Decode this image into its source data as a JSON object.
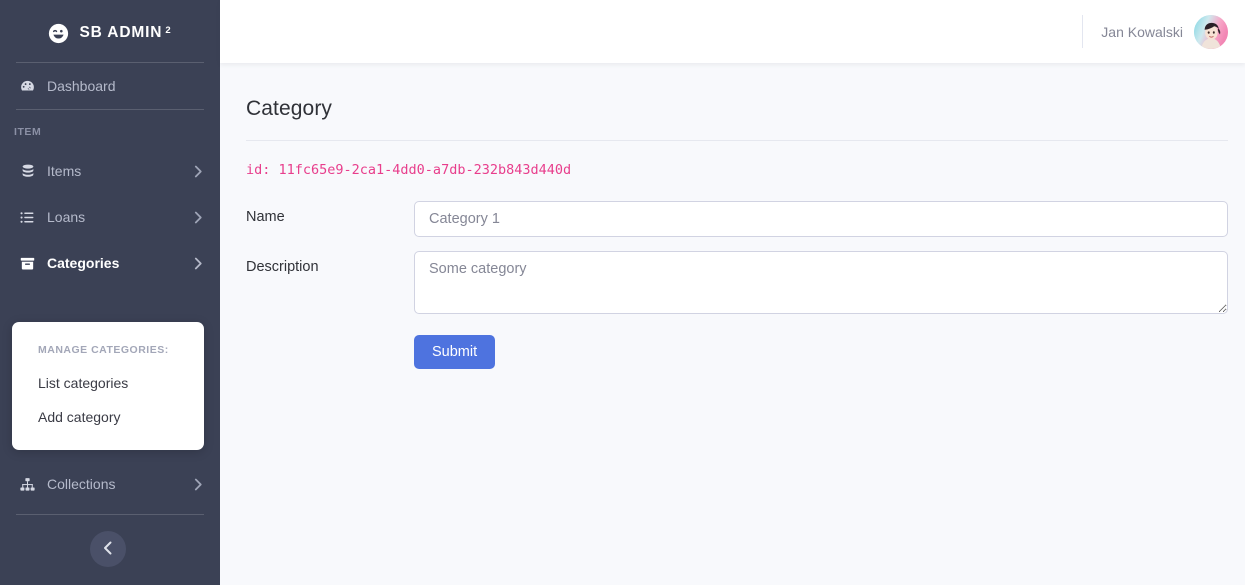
{
  "sidebar": {
    "brand": {
      "name": "SB ADMIN",
      "superscript": "2",
      "icon": "smiley-wink-icon"
    },
    "items": [
      {
        "label": "Dashboard",
        "icon": "tachometer-icon",
        "active": false,
        "chevron": false
      },
      {
        "label": "Items",
        "icon": "database-icon",
        "active": false,
        "chevron": true
      },
      {
        "label": "Loans",
        "icon": "list-icon",
        "active": false,
        "chevron": true
      },
      {
        "label": "Categories",
        "icon": "archive-box-icon",
        "active": true,
        "chevron": true
      },
      {
        "label": "Collections",
        "icon": "sitemap-icon",
        "active": false,
        "chevron": true
      }
    ],
    "heading_item": "ITEM",
    "submenu": {
      "title": "MANAGE CATEGORIES:",
      "links": [
        {
          "label": "List categories"
        },
        {
          "label": "Add category"
        }
      ]
    },
    "toggle_icon": "chevron-left-icon"
  },
  "topbar": {
    "user_name": "Jan Kowalski",
    "avatar_alt": "user-avatar"
  },
  "main": {
    "page_title": "Category",
    "record_id": "id: 11fc65e9-2ca1-4dd0-a7db-232b843d440d",
    "fields": [
      {
        "label": "Name",
        "placeholder": "Category 1",
        "value": ""
      },
      {
        "label": "Description",
        "placeholder": "Some category",
        "value": ""
      }
    ],
    "submit_label": "Submit"
  },
  "colors": {
    "sidebar_bg": "#3b4155",
    "content_bg": "#f8f9fc",
    "primary": "#4e73df",
    "id_text": "#e83e8c",
    "muted_text": "#858796"
  }
}
